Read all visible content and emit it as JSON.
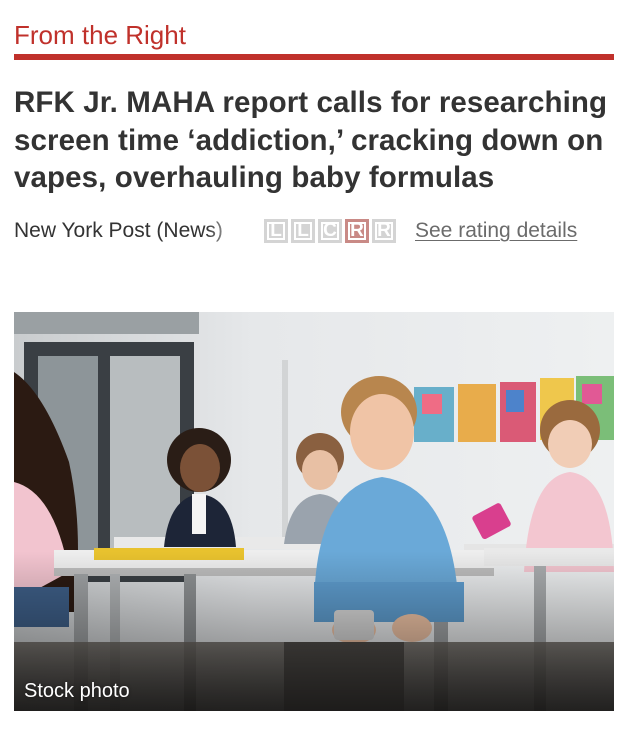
{
  "section": {
    "label": "From the Right",
    "accent_color": "#c0312b"
  },
  "article": {
    "headline": "RFK Jr. MAHA report calls for researching screen time ‘addiction,’ cracking down on vapes, overhauling baby formulas",
    "source": "New York Post (News)",
    "bias_rating": {
      "options": [
        "L",
        "L",
        "C",
        "R",
        "R"
      ],
      "active_index": 3
    },
    "rating_link": "See rating details",
    "photo": {
      "caption": "Stock photo",
      "icon": "classroom-photo"
    }
  }
}
